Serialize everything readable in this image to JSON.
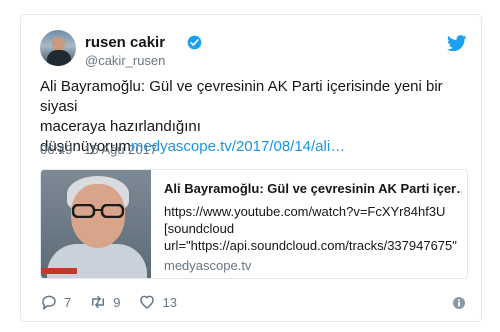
{
  "user": {
    "display_name": "rusen cakir",
    "handle": "@cakir_rusen",
    "verified_icon": "verified-badge-icon"
  },
  "tweet": {
    "text_lines": [
      "Ali Bayramoğlu: Gül ve çevresinin AK Parti içerisinde yeni bir siyasi",
      "maceraya hazırlandığını",
      "düşünüyorum"
    ],
    "link_text": "medyascope.tv/2017/08/14/ali…",
    "timestamp": "06:49 - 15 Ağu 2017"
  },
  "link_card": {
    "title": "Ali Bayramoğlu: Gül ve çevresinin AK Parti içer…",
    "description_lines": [
      "https://www.youtube.com/watch?v=FcXYr84hf3U",
      "[soundcloud",
      "url=\"https://api.soundcloud.com/tracks/337947675\""
    ],
    "domain": "medyascope.tv"
  },
  "actions": {
    "replies": "7",
    "retweets": "9",
    "likes": "13"
  },
  "colors": {
    "link": "#1b95e0",
    "muted": "#657786",
    "twitter_blue": "#1da1f2"
  }
}
